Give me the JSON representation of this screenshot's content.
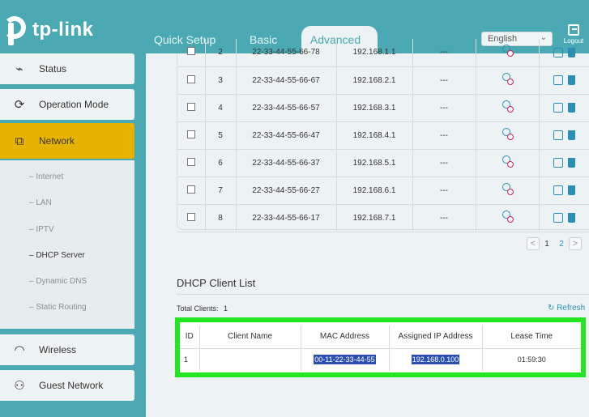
{
  "header": {
    "logo_text": "tp-link",
    "tabs": [
      {
        "label": "Quick Setup"
      },
      {
        "label": "Basic"
      },
      {
        "label": "Advanced"
      }
    ],
    "language": "English",
    "logout": "Logout"
  },
  "sidebar": {
    "items": [
      {
        "label": "Status",
        "icon": "pulse-icon"
      },
      {
        "label": "Operation Mode",
        "icon": "cycle-icon"
      },
      {
        "label": "Network",
        "icon": "network-icon"
      },
      {
        "label": "Wireless",
        "icon": "wifi-icon"
      },
      {
        "label": "Guest Network",
        "icon": "guests-icon"
      }
    ],
    "submenu": [
      {
        "label": "– Internet"
      },
      {
        "label": "– LAN"
      },
      {
        "label": "– IPTV"
      },
      {
        "label": "– DHCP Server"
      },
      {
        "label": "– Dynamic DNS"
      },
      {
        "label": "– Static Routing"
      }
    ]
  },
  "reservations": {
    "rows": [
      {
        "n": "2",
        "mac": "22-33-44-55-66-78",
        "ip": "192.168.1.1",
        "desc": "---"
      },
      {
        "n": "3",
        "mac": "22-33-44-55-66-67",
        "ip": "192.168.2.1",
        "desc": "---"
      },
      {
        "n": "4",
        "mac": "22-33-44-55-66-57",
        "ip": "192.168.3.1",
        "desc": "---"
      },
      {
        "n": "5",
        "mac": "22-33-44-55-66-47",
        "ip": "192.168.4.1",
        "desc": "---"
      },
      {
        "n": "6",
        "mac": "22-33-44-55-66-37",
        "ip": "192.168.5.1",
        "desc": "---"
      },
      {
        "n": "7",
        "mac": "22-33-44-55-66-27",
        "ip": "192.168.6.1",
        "desc": "---"
      },
      {
        "n": "8",
        "mac": "22-33-44-55-66-17",
        "ip": "192.168.7.1",
        "desc": "---"
      }
    ],
    "pager": {
      "prev": "<",
      "pages": [
        "1",
        "2"
      ],
      "next": ">"
    }
  },
  "client_list": {
    "title": "DHCP Client List",
    "total_label": "Total Clients:",
    "total_value": "1",
    "refresh": "Refresh",
    "headers": [
      "ID",
      "Client Name",
      "MAC Address",
      "Assigned IP Address",
      "Lease Time"
    ],
    "rows": [
      {
        "id": "1",
        "name": "",
        "mac": "00-11-22-33-44-55",
        "ip": "192.168.0.100",
        "lease": "01:59:30"
      }
    ]
  }
}
